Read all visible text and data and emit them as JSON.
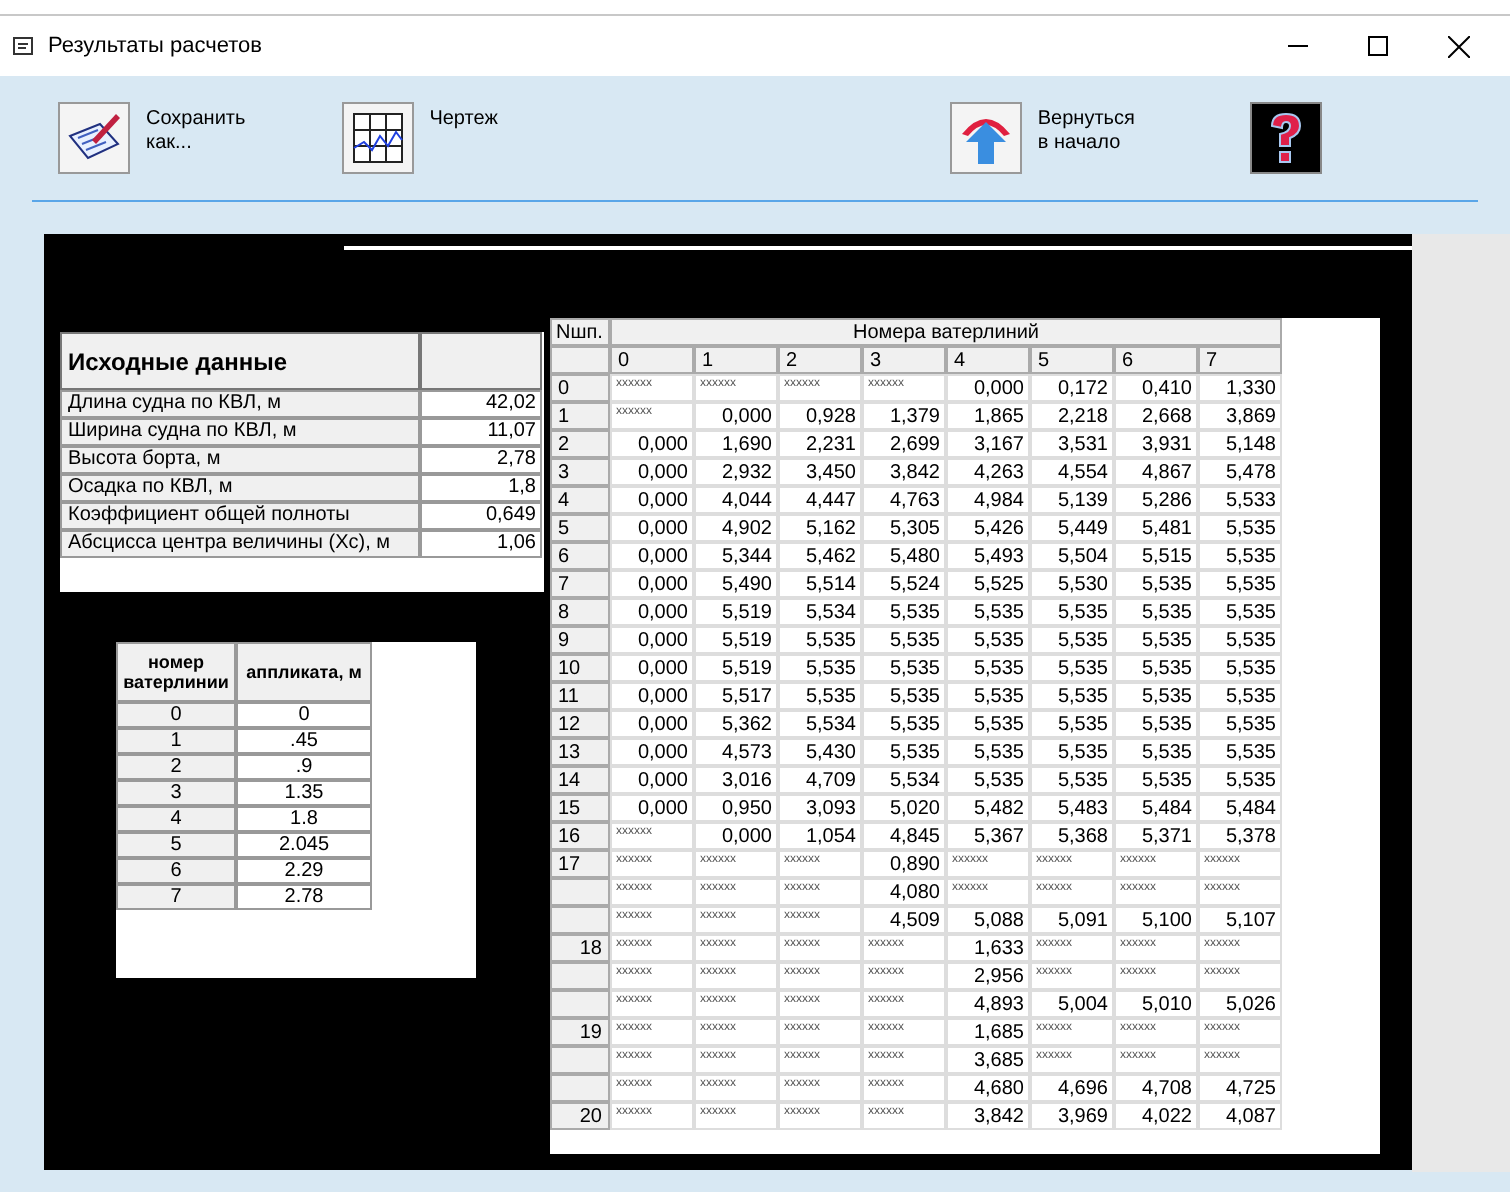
{
  "window": {
    "title": "Результаты расчетов"
  },
  "toolbar": [
    {
      "kind": "save",
      "label": "Сохранить\nкак..."
    },
    {
      "kind": "drawing",
      "label": "Чертеж"
    },
    {
      "kind": "home",
      "label": "Вернуться\nв начало"
    },
    {
      "kind": "help"
    }
  ],
  "source_data": {
    "title": "Исходные данные",
    "rows": [
      {
        "label": "Длина судна по КВЛ, м",
        "value": "42,02"
      },
      {
        "label": "Ширина судна по КВЛ, м",
        "value": "11,07"
      },
      {
        "label": "Высота борта, м",
        "value": "2,78"
      },
      {
        "label": "Осадка по КВЛ, м",
        "value": "1,8"
      },
      {
        "label": "Коэффициент общей полноты",
        "value": "0,649"
      },
      {
        "label": "Абсцисса центра величины (Xc), м",
        "value": "1,06"
      }
    ]
  },
  "waterlines": {
    "columns": [
      "номер ватерлинии",
      "аппликата, м"
    ],
    "rows": [
      [
        "0",
        "0"
      ],
      [
        "1",
        ".45"
      ],
      [
        "2",
        ".9"
      ],
      [
        "3",
        "1.35"
      ],
      [
        "4",
        "1.8"
      ],
      [
        "5",
        "2.045"
      ],
      [
        "6",
        "2.29"
      ],
      [
        "7",
        "2.78"
      ]
    ]
  },
  "offsets": {
    "corner": "Nшп.",
    "group_header": "Номера ватерлиний",
    "columns": [
      "0",
      "1",
      "2",
      "3",
      "4",
      "5",
      "6",
      "7"
    ],
    "rows": [
      {
        "label": "0",
        "cells": [
          {
            "masked": "xxxxxx"
          },
          {
            "masked": "xxxxxx"
          },
          {
            "masked": "xxxxxx"
          },
          {
            "masked": "xxxxxx"
          },
          "0,000",
          "0,172",
          "0,410",
          "1,330"
        ]
      },
      {
        "label": "1",
        "cells": [
          {
            "masked": "xxxxxx"
          },
          "0,000",
          "0,928",
          "1,379",
          "1,865",
          "2,218",
          "2,668",
          "3,869"
        ]
      },
      {
        "label": "2",
        "cells": [
          "0,000",
          "1,690",
          "2,231",
          "2,699",
          "3,167",
          "3,531",
          "3,931",
          "5,148"
        ]
      },
      {
        "label": "3",
        "cells": [
          "0,000",
          "2,932",
          "3,450",
          "3,842",
          "4,263",
          "4,554",
          "4,867",
          "5,478"
        ]
      },
      {
        "label": "4",
        "cells": [
          "0,000",
          "4,044",
          "4,447",
          "4,763",
          "4,984",
          "5,139",
          "5,286",
          "5,533"
        ]
      },
      {
        "label": "5",
        "cells": [
          "0,000",
          "4,902",
          "5,162",
          "5,305",
          "5,426",
          "5,449",
          "5,481",
          "5,535"
        ]
      },
      {
        "label": "6",
        "cells": [
          "0,000",
          "5,344",
          "5,462",
          "5,480",
          "5,493",
          "5,504",
          "5,515",
          "5,535"
        ]
      },
      {
        "label": "7",
        "cells": [
          "0,000",
          "5,490",
          "5,514",
          "5,524",
          "5,525",
          "5,530",
          "5,535",
          "5,535"
        ]
      },
      {
        "label": "8",
        "cells": [
          "0,000",
          "5,519",
          "5,534",
          "5,535",
          "5,535",
          "5,535",
          "5,535",
          "5,535"
        ]
      },
      {
        "label": "9",
        "cells": [
          "0,000",
          "5,519",
          "5,535",
          "5,535",
          "5,535",
          "5,535",
          "5,535",
          "5,535"
        ]
      },
      {
        "label": "10",
        "cells": [
          "0,000",
          "5,519",
          "5,535",
          "5,535",
          "5,535",
          "5,535",
          "5,535",
          "5,535"
        ]
      },
      {
        "label": "11",
        "cells": [
          "0,000",
          "5,517",
          "5,535",
          "5,535",
          "5,535",
          "5,535",
          "5,535",
          "5,535"
        ]
      },
      {
        "label": "12",
        "cells": [
          "0,000",
          "5,362",
          "5,534",
          "5,535",
          "5,535",
          "5,535",
          "5,535",
          "5,535"
        ]
      },
      {
        "label": "13",
        "cells": [
          "0,000",
          "4,573",
          "5,430",
          "5,535",
          "5,535",
          "5,535",
          "5,535",
          "5,535"
        ]
      },
      {
        "label": "14",
        "cells": [
          "0,000",
          "3,016",
          "4,709",
          "5,534",
          "5,535",
          "5,535",
          "5,535",
          "5,535"
        ]
      },
      {
        "label": "15",
        "cells": [
          "0,000",
          "0,950",
          "3,093",
          "5,020",
          "5,482",
          "5,483",
          "5,484",
          "5,484"
        ]
      },
      {
        "label": "16",
        "cells": [
          {
            "masked": "xxxxxx"
          },
          "0,000",
          "1,054",
          "4,845",
          "5,367",
          "5,368",
          "5,371",
          "5,378"
        ]
      },
      {
        "label": "17",
        "cells": [
          {
            "masked": "xxxxxx"
          },
          {
            "masked": "xxxxxx"
          },
          {
            "masked": "xxxxxx"
          },
          "0,890",
          {
            "masked": "xxxxxx"
          },
          {
            "masked": "xxxxxx"
          },
          {
            "masked": "xxxxxx"
          },
          {
            "masked": "xxxxxx"
          }
        ]
      },
      {
        "cells": [
          {
            "masked": "xxxxxx"
          },
          {
            "masked": "xxxxxx"
          },
          {
            "masked": "xxxxxx"
          },
          "4,080",
          {
            "masked": "xxxxxx"
          },
          {
            "masked": "xxxxxx"
          },
          {
            "masked": "xxxxxx"
          },
          {
            "masked": "xxxxxx"
          }
        ]
      },
      {
        "cells": [
          {
            "masked": "xxxxxx"
          },
          {
            "masked": "xxxxxx"
          },
          {
            "masked": "xxxxxx"
          },
          "4,509",
          "5,088",
          "5,091",
          "5,100",
          "5,107"
        ]
      },
      {
        "label": "18",
        "cells": [
          {
            "masked": "xxxxxx"
          },
          {
            "masked": "xxxxxx"
          },
          {
            "masked": "xxxxxx"
          },
          {
            "masked": "xxxxxx"
          },
          "1,633",
          {
            "masked": "xxxxxx"
          },
          {
            "masked": "xxxxxx"
          },
          {
            "masked": "xxxxxx"
          }
        ]
      },
      {
        "cells": [
          {
            "masked": "xxxxxx"
          },
          {
            "masked": "xxxxxx"
          },
          {
            "masked": "xxxxxx"
          },
          {
            "masked": "xxxxxx"
          },
          "2,956",
          {
            "masked": "xxxxxx"
          },
          {
            "masked": "xxxxxx"
          },
          {
            "masked": "xxxxxx"
          }
        ]
      },
      {
        "cells": [
          {
            "masked": "xxxxxx"
          },
          {
            "masked": "xxxxxx"
          },
          {
            "masked": "xxxxxx"
          },
          {
            "masked": "xxxxxx"
          },
          "4,893",
          "5,004",
          "5,010",
          "5,026"
        ]
      },
      {
        "label": "19",
        "cells": [
          {
            "masked": "xxxxxx"
          },
          {
            "masked": "xxxxxx"
          },
          {
            "masked": "xxxxxx"
          },
          {
            "masked": "xxxxxx"
          },
          "1,685",
          {
            "masked": "xxxxxx"
          },
          {
            "masked": "xxxxxx"
          },
          {
            "masked": "xxxxxx"
          }
        ]
      },
      {
        "cells": [
          {
            "masked": "xxxxxx"
          },
          {
            "masked": "xxxxxx"
          },
          {
            "masked": "xxxxxx"
          },
          {
            "masked": "xxxxxx"
          },
          "3,685",
          {
            "masked": "xxxxxx"
          },
          {
            "masked": "xxxxxx"
          },
          {
            "masked": "xxxxxx"
          }
        ]
      },
      {
        "cells": [
          {
            "masked": "xxxxxx"
          },
          {
            "masked": "xxxxxx"
          },
          {
            "masked": "xxxxxx"
          },
          {
            "masked": "xxxxxx"
          },
          "4,680",
          "4,696",
          "4,708",
          "4,725"
        ]
      },
      {
        "label": "20",
        "cells": [
          {
            "masked": "xxxxxx"
          },
          {
            "masked": "xxxxxx"
          },
          {
            "masked": "xxxxxx"
          },
          {
            "masked": "xxxxxx"
          },
          "3,842",
          "3,969",
          "4,022",
          "4,087"
        ]
      }
    ]
  }
}
